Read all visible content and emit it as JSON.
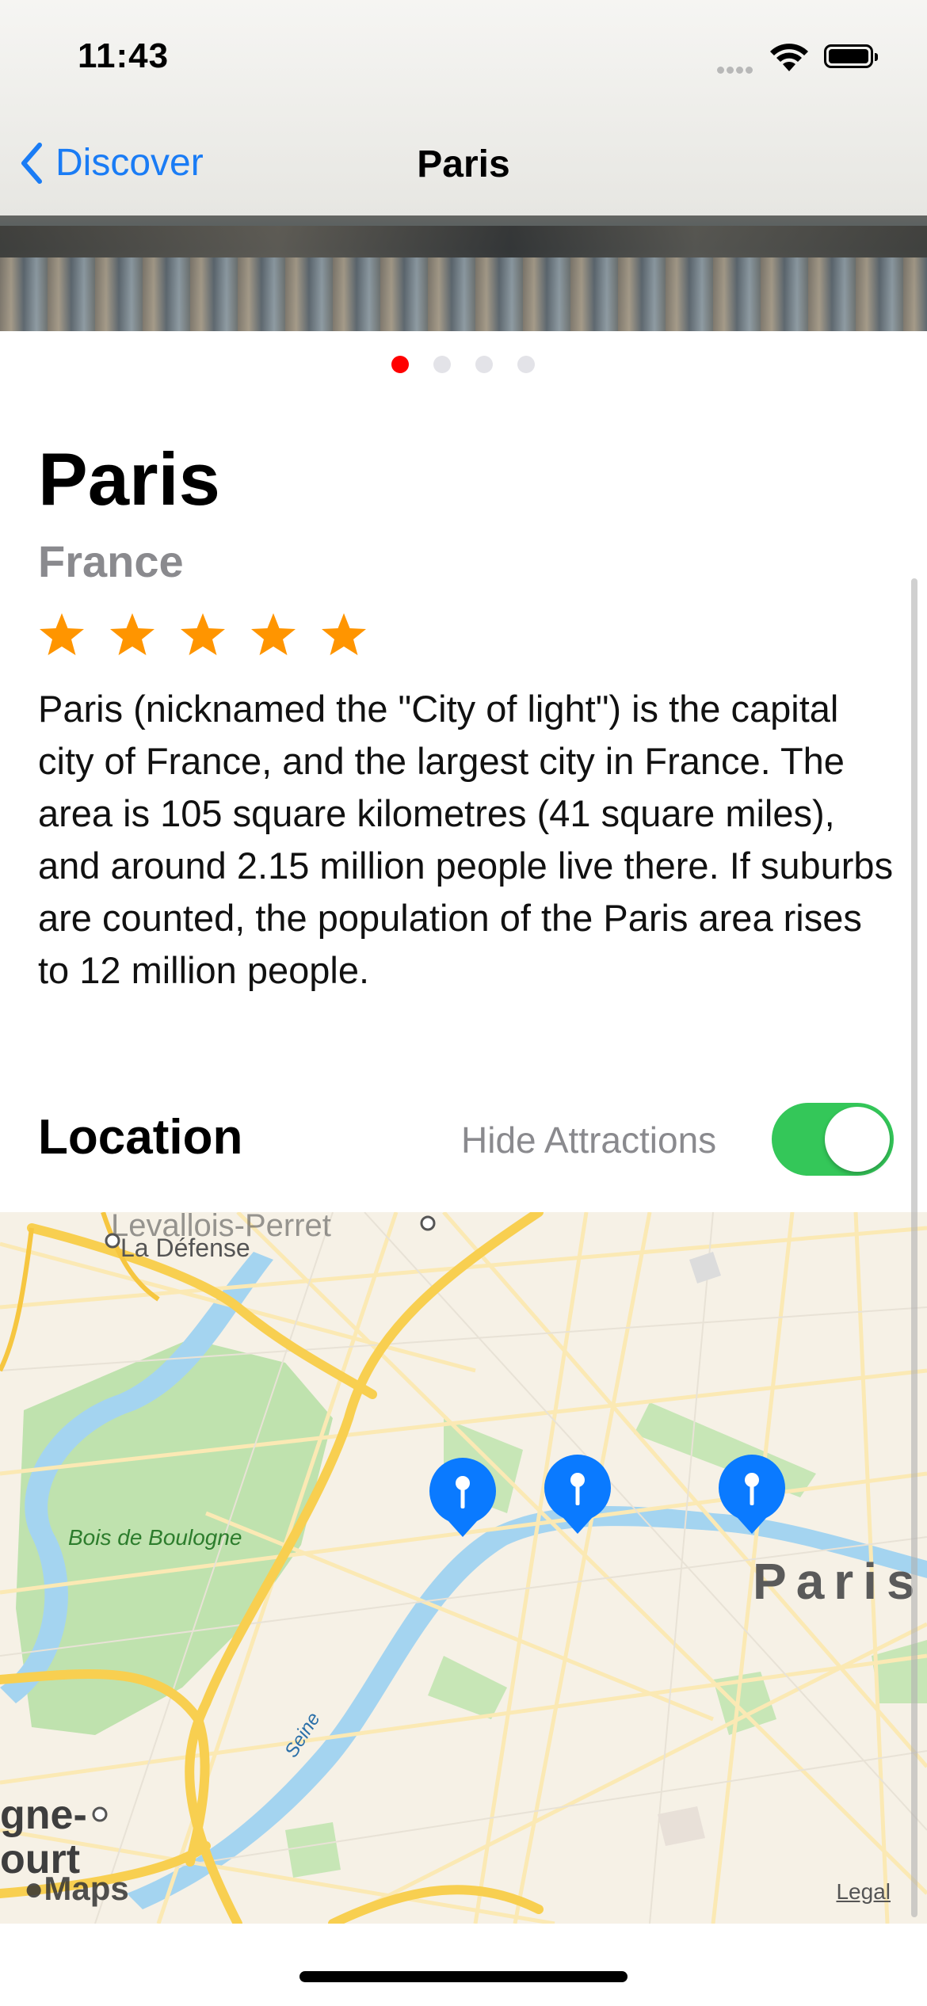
{
  "status_bar": {
    "time": "11:43"
  },
  "nav": {
    "back_label": "Discover",
    "title": "Paris"
  },
  "gallery": {
    "page_count": 4,
    "current_page": 1
  },
  "place": {
    "name": "Paris",
    "country": "France",
    "rating": 5,
    "rating_max": 5,
    "description": "Paris (nicknamed the \"City of light\") is the capital city of France, and the largest city in France. The area is 105 square kilometres (41 square miles), and around 2.15 million people live there. If suburbs are counted, the population of the Paris area rises to 12 million people."
  },
  "location": {
    "heading": "Location",
    "toggle_label": "Hide Attractions",
    "toggle_on": true
  },
  "map": {
    "labels": {
      "la_defense": "La Défense",
      "levallois": "Levallois-Perret",
      "bois": "Bois de Boulogne",
      "seine": "Seine",
      "city": "Paris",
      "boulogne_top": "gne-",
      "boulogne_bottom": "ourt"
    },
    "brand": "Maps",
    "legal": "Legal",
    "pin_count": 3
  },
  "colors": {
    "accent": "#1a7cf5",
    "star": "#ff9500",
    "toggle_on": "#34c759",
    "page_dot_active": "#ff0000",
    "pin": "#0a7aff"
  }
}
